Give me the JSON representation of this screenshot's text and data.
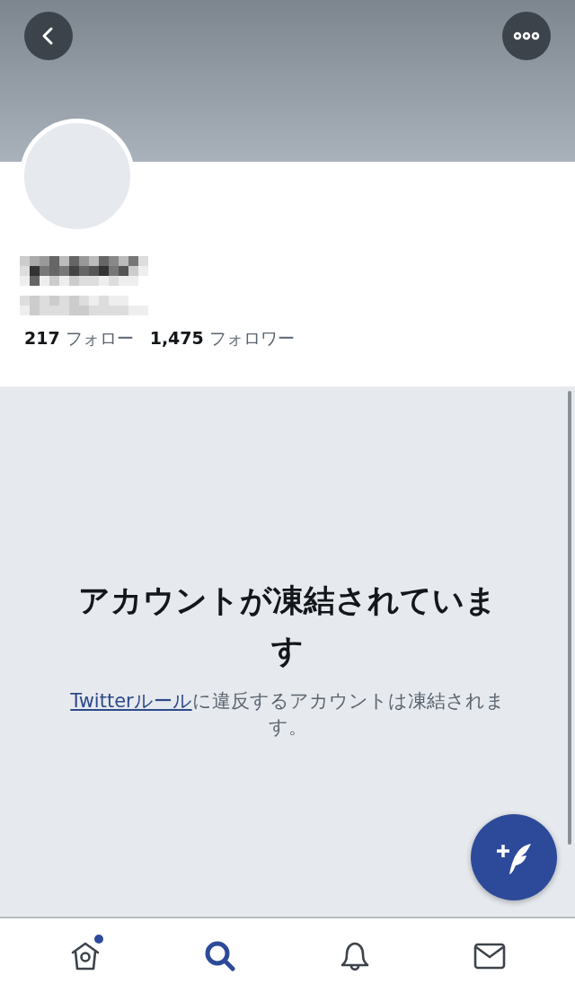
{
  "profile": {
    "stats": [
      {
        "count": "217",
        "label": "フォロー"
      },
      {
        "count": "1,475",
        "label": "フォロワー"
      }
    ]
  },
  "notice": {
    "title": "アカウントが凍結されています",
    "link": "Twitterルール",
    "message": "に違反するアカウントは凍結されます。"
  },
  "tabs": [
    {
      "kind": "home",
      "selected": false,
      "badge": true
    },
    {
      "kind": "search",
      "selected": true,
      "badge": false
    },
    {
      "kind": "bell",
      "selected": false,
      "badge": false
    },
    {
      "kind": "mail",
      "selected": false,
      "badge": false
    }
  ]
}
